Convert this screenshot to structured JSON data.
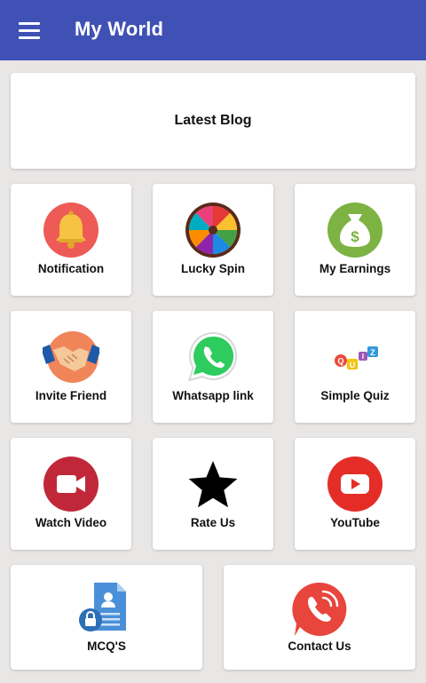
{
  "appbar": {
    "title": "My World",
    "menu_icon": "hamburger-menu-icon",
    "color": "#3f51b5"
  },
  "blog": {
    "label": "Latest Blog"
  },
  "tiles": [
    {
      "label": "Notification",
      "icon": "bell-icon"
    },
    {
      "label": "Lucky Spin",
      "icon": "spin-wheel-icon"
    },
    {
      "label": "My Earnings",
      "icon": "money-bag-icon"
    },
    {
      "label": "Invite Friend",
      "icon": "handshake-icon"
    },
    {
      "label": "Whatsapp link",
      "icon": "whatsapp-icon"
    },
    {
      "label": "Simple Quiz",
      "icon": "quiz-icon"
    },
    {
      "label": "Watch Video",
      "icon": "video-camera-icon"
    },
    {
      "label": "Rate Us",
      "icon": "star-icon"
    },
    {
      "label": "YouTube",
      "icon": "youtube-icon"
    },
    {
      "label": "MCQ'S",
      "icon": "document-lock-icon"
    },
    {
      "label": "Contact Us",
      "icon": "phone-call-icon"
    }
  ],
  "colors": {
    "background": "#e9e6e6",
    "card": "#ffffff"
  }
}
